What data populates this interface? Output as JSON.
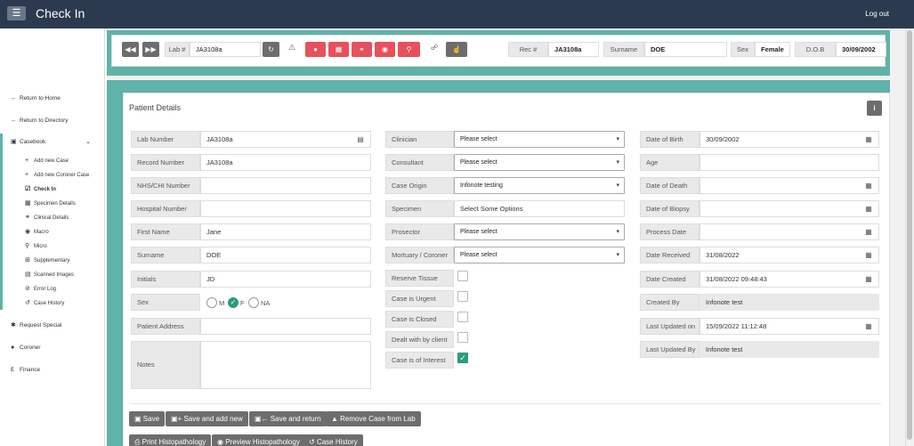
{
  "header": {
    "title": "Check In",
    "logout": "Log out"
  },
  "sidebar": {
    "return_home": "Return to Home",
    "return_directory": "Return to Directory",
    "casebook": "Casebook",
    "sub": [
      "Add new Case",
      "Add new Coroner Case",
      "Check In",
      "Specimen Details",
      "Clinical Details",
      "Macro",
      "Micro",
      "Supplementary",
      "Scanned Images",
      "Error Log",
      "Case History"
    ],
    "request_special": "Request Special",
    "coroner": "Coroner",
    "finance": "Finance"
  },
  "toolbar": {
    "lab_label": "Lab #",
    "lab_value": "JA3108a",
    "rec_label": "Rec #",
    "rec_value": "JA3108a",
    "surname_label": "Surname",
    "surname_value": "DOE",
    "sex_label": "Sex",
    "sex_value": "Female",
    "dob_label": "D.O.B",
    "dob_value": "30/09/2002"
  },
  "patient": {
    "title": "Patient Details",
    "lab_number": {
      "label": "Lab Number",
      "value": "JA3108a"
    },
    "record_number": {
      "label": "Record Number",
      "value": "JA3108a"
    },
    "nhs": {
      "label": "NHS/CHI Number",
      "value": ""
    },
    "hospital": {
      "label": "Hospital Number",
      "value": ""
    },
    "first_name": {
      "label": "First Name",
      "value": "Jane"
    },
    "surname": {
      "label": "Surname",
      "value": "DOE"
    },
    "initials": {
      "label": "Initials",
      "value": "JD"
    },
    "sex": {
      "label": "Sex",
      "options": [
        "M",
        "F",
        "NA"
      ],
      "selected": "F"
    },
    "address": {
      "label": "Patient Address",
      "value": ""
    },
    "notes": {
      "label": "Notes",
      "value": ""
    }
  },
  "case": {
    "clinician": {
      "label": "Clinician",
      "value": "Please select"
    },
    "consultant": {
      "label": "Consultant",
      "value": "Please select"
    },
    "case_origin": {
      "label": "Case Origin",
      "value": "Infonote testing"
    },
    "specimen": {
      "label": "Specimen",
      "value": "Select Some Options"
    },
    "prosector": {
      "label": "Prosector",
      "value": "Please select"
    },
    "mortuary": {
      "label": "Mortuary / Coroner",
      "value": "Please select"
    },
    "reserve_tissue": {
      "label": "Reserve Tissue",
      "checked": false
    },
    "urgent": {
      "label": "Case is Urgent",
      "checked": false
    },
    "closed": {
      "label": "Case is Closed",
      "checked": false
    },
    "dealt": {
      "label": "Dealt with by client",
      "checked": false
    },
    "interest": {
      "label": "Case is of Interest",
      "checked": true
    }
  },
  "dates": {
    "dob": {
      "label": "Date of Birth",
      "value": "30/09/2002"
    },
    "age": {
      "label": "Age",
      "value": ""
    },
    "death": {
      "label": "Date of Death",
      "value": ""
    },
    "biopsy": {
      "label": "Date of Biopsy",
      "value": ""
    },
    "process": {
      "label": "Process Date",
      "value": ""
    },
    "received": {
      "label": "Date Received",
      "value": "31/08/2022"
    },
    "created": {
      "label": "Date Created",
      "value": "31/08/2022 09:48:43"
    },
    "created_by": {
      "label": "Created By",
      "value": "Infonote test"
    },
    "last_updated_on": {
      "label": "Last Updated on",
      "value": "15/09/2022 11:12:48"
    },
    "last_updated_by": {
      "label": "Last Updated By",
      "value": "Infonote test"
    }
  },
  "actions": {
    "save": "Save",
    "save_add_new": "Save and add new",
    "save_return": "Save and return",
    "remove": "Remove Case from Lab",
    "print": "Print Histopathology",
    "preview": "Preview Histopathology",
    "history": "Case History"
  }
}
